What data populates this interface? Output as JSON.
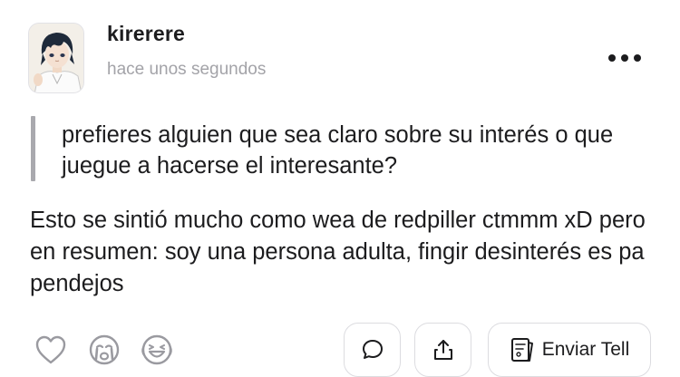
{
  "post": {
    "author": "kirerere",
    "time": "hace unos segundos",
    "question": "prefieres alguien que sea claro sobre su interés o que juegue a hacerse el interesante?",
    "answer": "Esto se sintió mucho como wea de redpiller ctmmm xD pero en resumen: soy una persona adulta, fingir desinterés es pa pendejos"
  },
  "reactions": [
    {
      "icon": "heart-outline-icon"
    },
    {
      "icon": "crying-face-icon"
    },
    {
      "icon": "laughing-face-icon"
    }
  ],
  "actions": {
    "comment_icon": "comment-bubble-icon",
    "share_icon": "share-icon",
    "send_icon": "tell-card-icon",
    "send_label": "Enviar Tell"
  },
  "colors": {
    "text": "#1c1c1e",
    "muted": "#a3a3a8",
    "quote_bar": "#a9a9ae",
    "border": "#dcdce0"
  }
}
